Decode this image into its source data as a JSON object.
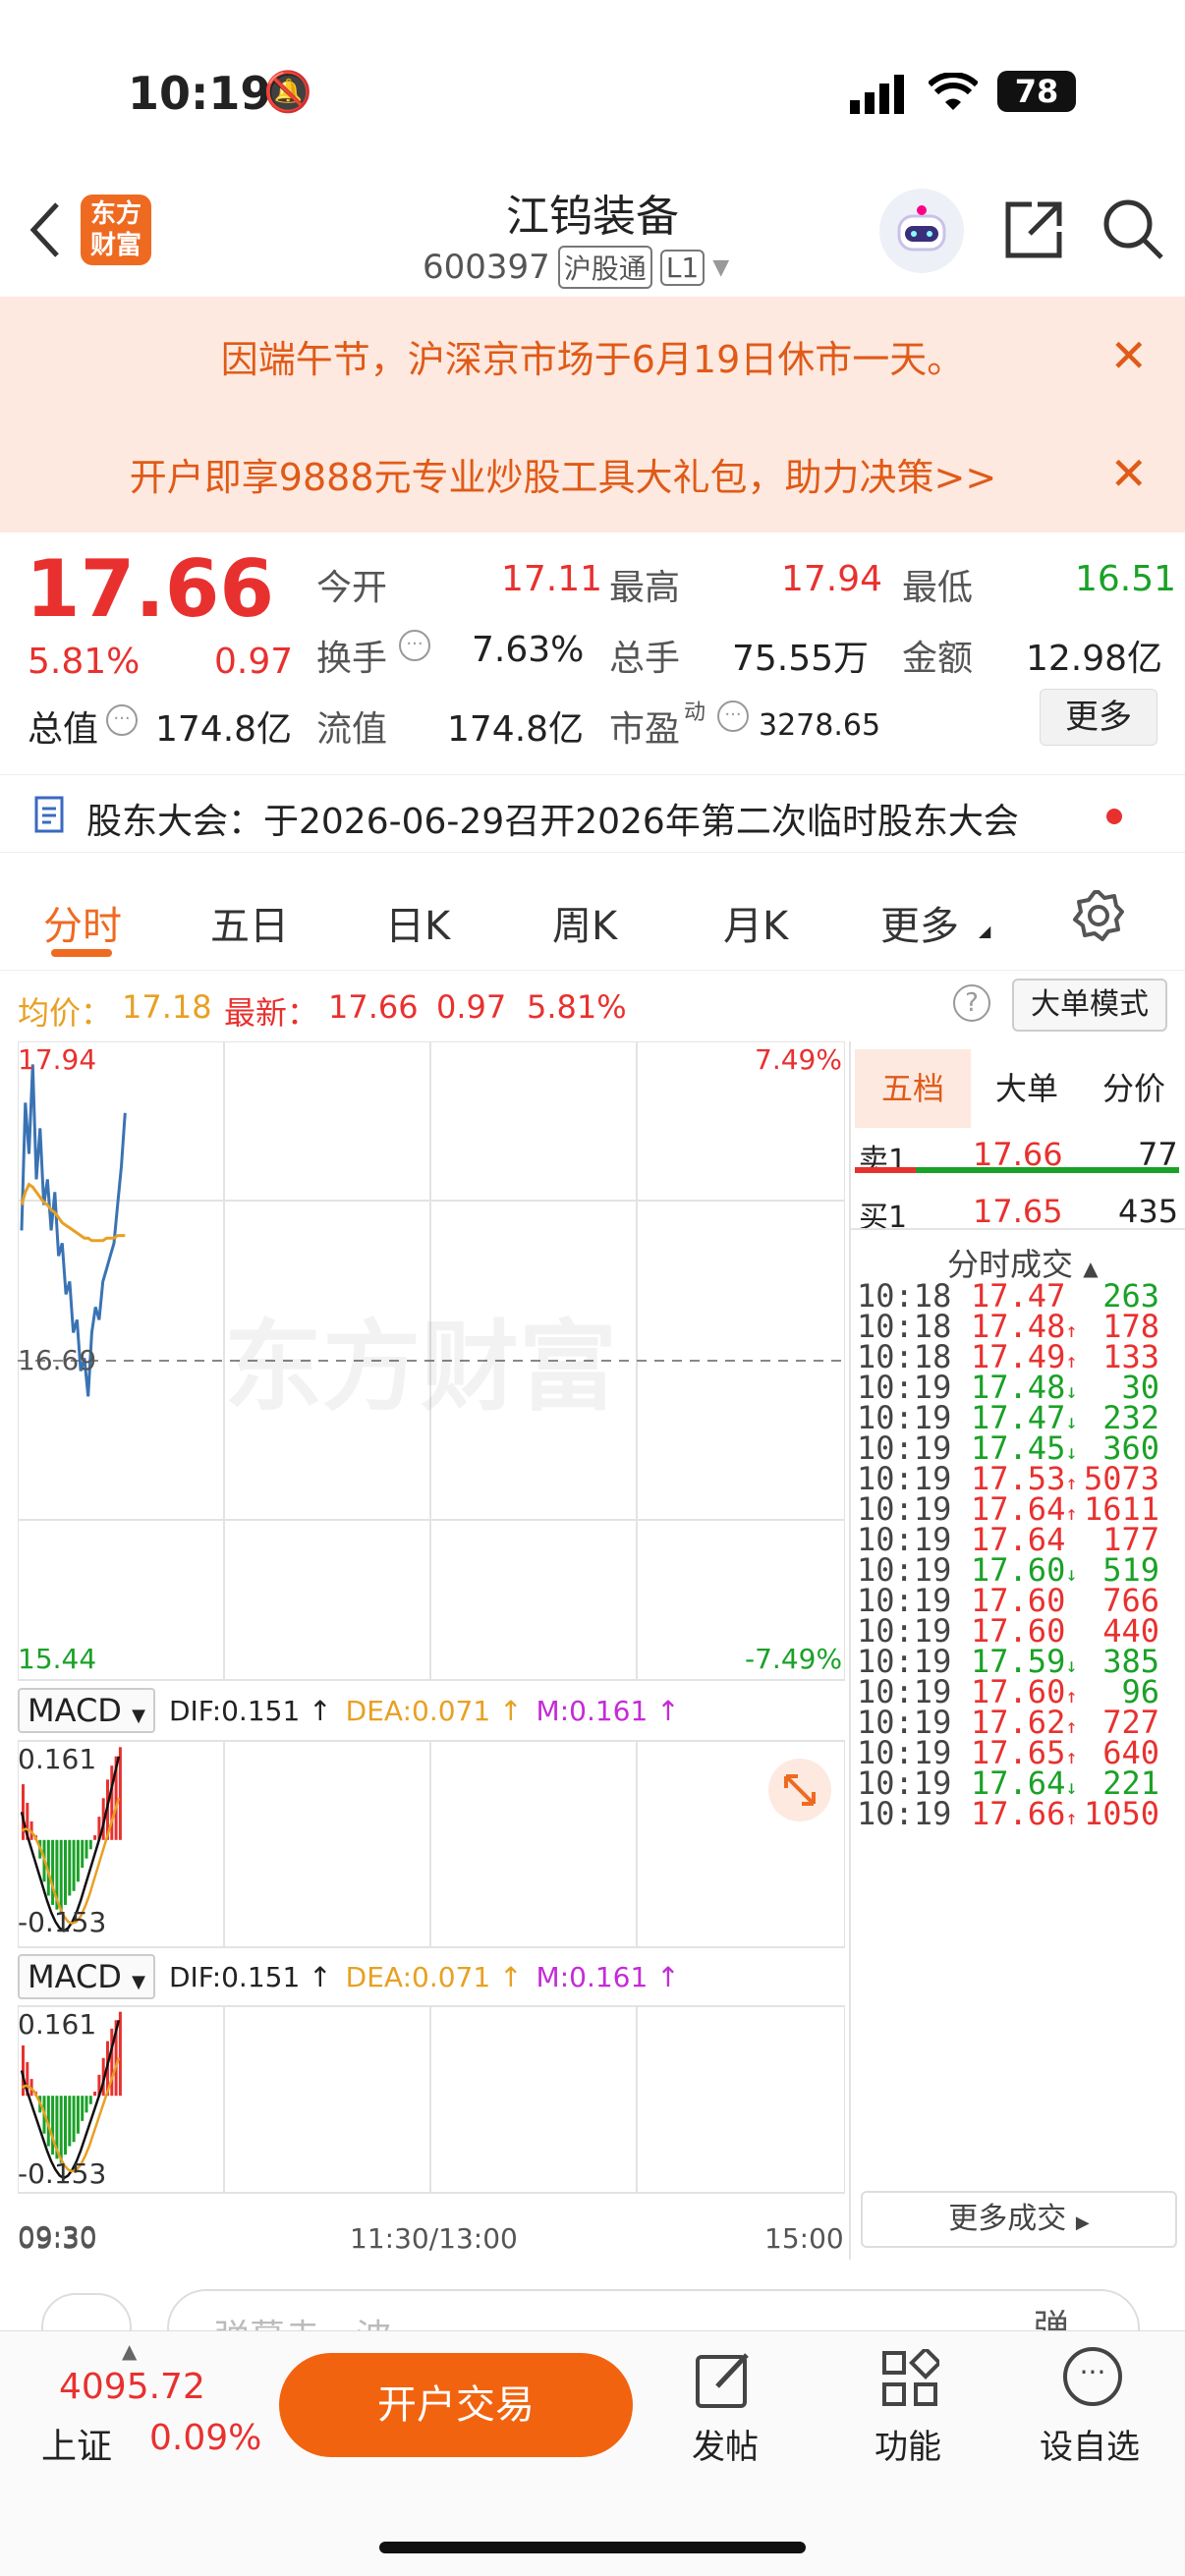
{
  "status": {
    "time": "10:19",
    "battery": "78"
  },
  "header": {
    "logo": "东方\n财富",
    "title": "江钨装备",
    "code": "600397",
    "badge_hk": "沪股通",
    "badge_l": "L1"
  },
  "notices": [
    {
      "text": "因端午节，沪深京市场于6月19日休市一天。"
    },
    {
      "text": "开户即享9888元专业炒股工具大礼包，助力决策>>"
    }
  ],
  "quote": {
    "price": "17.66",
    "pct": "5.81%",
    "chg": "0.97",
    "open_label": "今开",
    "open": "17.11",
    "high_label": "最高",
    "high": "17.94",
    "low_label": "最低",
    "low": "16.51",
    "turnover_label": "换手",
    "turnover": "7.63%",
    "vol_label": "总手",
    "vol": "75.55万",
    "amount_label": "金额",
    "amount": "12.98亿",
    "mktcap_label": "总值",
    "mktcap": "174.8亿",
    "float_label": "流值",
    "float": "174.8亿",
    "pe_label": "市盈",
    "pe_sup": "动",
    "pe": "3278.65",
    "more": "更多"
  },
  "announce": {
    "text": "股东大会：于2026-06-29召开2026年第二次临时股东大会"
  },
  "tabs": [
    "分时",
    "五日",
    "日K",
    "周K",
    "月K",
    "更多"
  ],
  "chart_bar": {
    "avg_label": "均价：",
    "avg": "17.18",
    "latest_label": "最新：",
    "latest": "17.66",
    "chg": "0.97",
    "pct": "5.81%",
    "mode": "大单模式"
  },
  "chart": {
    "y_top": "17.94",
    "y_mid": "16.69",
    "y_bot": "15.44",
    "pct_top": "7.49%",
    "pct_bot": "-7.49%",
    "watermark": "东方财富",
    "x_start": "09:30",
    "x_mid": "11:30/13:00",
    "x_end": "15:00"
  },
  "chart_data": {
    "type": "line",
    "series": [
      {
        "name": "price",
        "values": [
          17.2,
          17.7,
          17.5,
          17.85,
          17.4,
          17.6,
          17.3,
          17.4,
          17.2,
          17.35,
          17.1,
          17.15,
          16.95,
          17.0,
          16.8,
          16.85,
          16.65,
          16.7,
          16.55,
          16.8,
          16.9,
          16.85,
          17.0,
          17.05,
          17.1,
          17.15,
          17.3,
          17.45,
          17.66
        ]
      },
      {
        "name": "avg",
        "values": [
          17.3,
          17.35,
          17.38,
          17.37,
          17.35,
          17.33,
          17.31,
          17.3,
          17.28,
          17.27,
          17.25,
          17.23,
          17.22,
          17.21,
          17.2,
          17.19,
          17.18,
          17.17,
          17.17,
          17.16,
          17.16,
          17.16,
          17.16,
          17.17,
          17.17,
          17.17,
          17.18,
          17.18,
          17.18
        ]
      }
    ],
    "ylim": [
      15.44,
      17.94
    ]
  },
  "macd": {
    "label": "MACD",
    "dif": "DIF:0.151",
    "dea": "DEA:0.071",
    "m": "M:0.161",
    "top": "0.161",
    "bot": "-0.153"
  },
  "book": {
    "tabs": [
      "五档",
      "大单",
      "分价"
    ],
    "sell_label": "卖1",
    "sell_price": "17.66",
    "sell_vol": "77",
    "buy_label": "买1",
    "buy_price": "17.65",
    "buy_vol": "435",
    "trades_title": "分时成交",
    "trades": [
      {
        "t": "10:18",
        "p": "17.47",
        "d": "",
        "v": "263",
        "c": "green"
      },
      {
        "t": "10:18",
        "p": "17.48",
        "d": "↑",
        "v": "178",
        "c": "red"
      },
      {
        "t": "10:18",
        "p": "17.49",
        "d": "↑",
        "v": "133",
        "c": "red"
      },
      {
        "t": "10:19",
        "p": "17.48",
        "d": "↓",
        "v": "30",
        "c": "green"
      },
      {
        "t": "10:19",
        "p": "17.47",
        "d": "↓",
        "v": "232",
        "c": "green"
      },
      {
        "t": "10:19",
        "p": "17.45",
        "d": "↓",
        "v": "360",
        "c": "green"
      },
      {
        "t": "10:19",
        "p": "17.53",
        "d": "↑",
        "v": "5073",
        "c": "red"
      },
      {
        "t": "10:19",
        "p": "17.64",
        "d": "↑",
        "v": "1611",
        "c": "red"
      },
      {
        "t": "10:19",
        "p": "17.64",
        "d": "",
        "v": "177",
        "c": "red"
      },
      {
        "t": "10:19",
        "p": "17.60",
        "d": "↓",
        "v": "519",
        "c": "green"
      },
      {
        "t": "10:19",
        "p": "17.60",
        "d": "",
        "v": "766",
        "c": "red"
      },
      {
        "t": "10:19",
        "p": "17.60",
        "d": "",
        "v": "440",
        "c": "red"
      },
      {
        "t": "10:19",
        "p": "17.59",
        "d": "↓",
        "v": "385",
        "c": "green"
      },
      {
        "t": "10:19",
        "p": "17.60",
        "d": "↑",
        "v": "96",
        "c": "green"
      },
      {
        "t": "10:19",
        "p": "17.62",
        "d": "↑",
        "v": "727",
        "c": "red"
      },
      {
        "t": "10:19",
        "p": "17.65",
        "d": "↑",
        "v": "640",
        "c": "red"
      },
      {
        "t": "10:19",
        "p": "17.64",
        "d": "↓",
        "v": "221",
        "c": "green"
      },
      {
        "t": "10:19",
        "p": "17.66",
        "d": "↑",
        "v": "1050",
        "c": "red"
      }
    ],
    "more": "更多成交"
  },
  "danmu": {
    "placeholder": "弹幕走一波",
    "btn": "弹"
  },
  "bottom": {
    "index_value": "4095.72",
    "index_name": "上证",
    "index_pct": "0.09%",
    "trade_btn": "开户交易",
    "post": "发帖",
    "func": "功能",
    "watch": "设自选"
  }
}
